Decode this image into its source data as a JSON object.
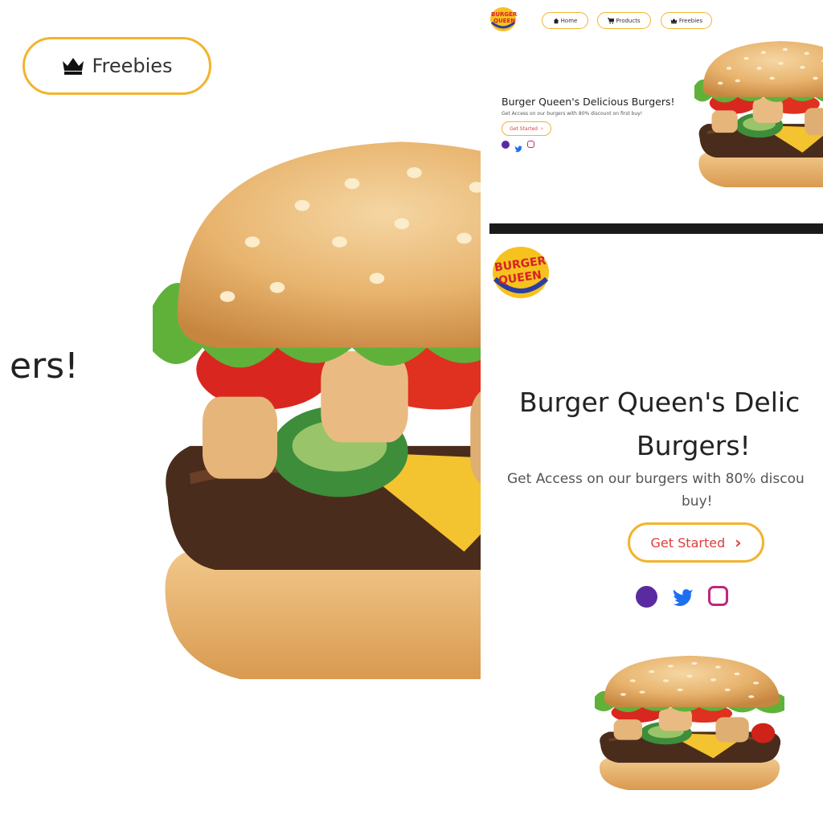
{
  "left_panel": {
    "nav_freebies_label": "Freebies",
    "heading_fragment": "ers!"
  },
  "top_right": {
    "logo_text_top": "BURGER",
    "logo_text_bottom": "QUEEN",
    "nav": [
      {
        "label": "Home",
        "icon": "home-icon"
      },
      {
        "label": "Products",
        "icon": "cart-icon"
      },
      {
        "label": "Freebies",
        "icon": "crown-icon"
      }
    ],
    "hero_title": "Burger Queen's Delicious Burgers!",
    "hero_sub": "Get Access on our burgers with 80% discount on first buy!",
    "cta_label": "Get Started",
    "social": [
      "facebook-icon",
      "twitter-icon",
      "instagram-icon"
    ]
  },
  "bottom_right": {
    "logo_text_top": "BURGER",
    "logo_text_bottom": "QUEEN",
    "hero_title_line1": "Burger Queen's Delic",
    "hero_title_line2": "Burgers!",
    "hero_sub_line1": "Get Access on our burgers with 80% discou",
    "hero_sub_line2": "buy!",
    "cta_label": "Get Started"
  },
  "colors": {
    "accent": "#f2b42e",
    "cta_text": "#e23b3b",
    "facebook": "#5a2aa0",
    "twitter": "#1d6ff2",
    "instagram": "#c0267f"
  }
}
